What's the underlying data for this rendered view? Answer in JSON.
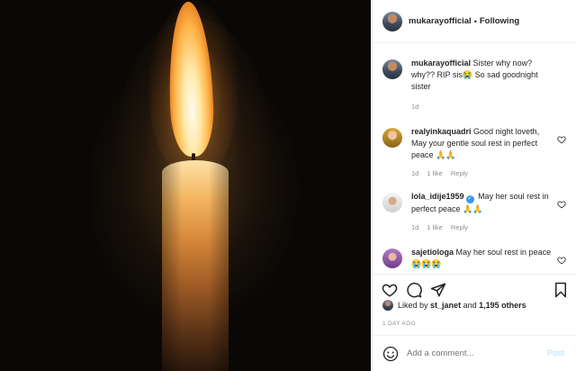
{
  "post": {
    "username": "mukarayofficial",
    "follow_separator": "•",
    "follow_status": "Following"
  },
  "comments": [
    {
      "username": "mukarayofficial",
      "text": "Sister why now? why?? RIP sis😭 So sad goodnight sister",
      "time": "1d"
    },
    {
      "username": "realyinkaquadri",
      "text": "Good night loveth, May your gentle soul rest in perfect peace 🙏🙏",
      "time": "1d",
      "likes": "1 like",
      "reply": "Reply"
    },
    {
      "username": "lola_idije1959",
      "verified": true,
      "text": "May her soul rest in perfect peace 🙏🙏",
      "time": "1d",
      "likes": "1 like",
      "reply": "Reply"
    },
    {
      "username": "sajetiologa",
      "text": "May her soul rest in peace 😭😭😭"
    }
  ],
  "likes": {
    "prefix": "Liked by",
    "user": "st_janet",
    "conjunction": "and",
    "others": "1,195 others"
  },
  "timestamp": "1 DAY AGO",
  "add_comment": {
    "placeholder": "Add a comment...",
    "post_label": "Post"
  },
  "icons": {
    "like": "heart-icon",
    "comment": "comment-bubble-icon",
    "share": "paper-plane-icon",
    "save": "bookmark-icon",
    "emoji": "smiley-icon"
  },
  "colors": {
    "accent": "#3897f0",
    "post_disabled": "#b2dffc",
    "muted": "#8e8e8e"
  }
}
